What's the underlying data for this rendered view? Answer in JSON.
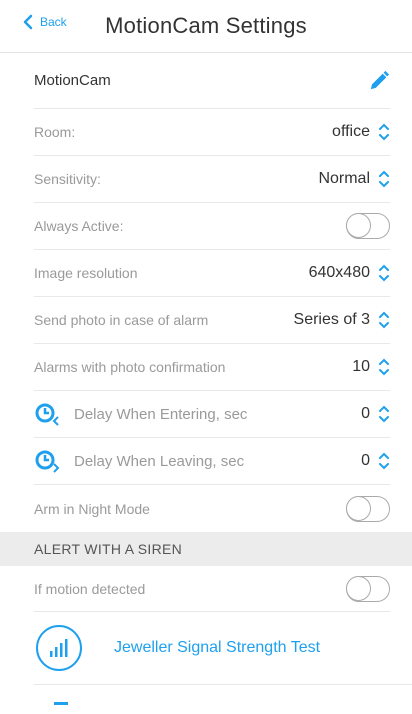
{
  "header": {
    "back_label": "Back",
    "title": "MotionCam Settings"
  },
  "device": {
    "name": "MotionCam",
    "edit_icon": "pencil-icon"
  },
  "settings": {
    "room": {
      "label": "Room:",
      "value": "office"
    },
    "sensitivity": {
      "label": "Sensitivity:",
      "value": "Normal"
    },
    "always_active": {
      "label": "Always Active:"
    },
    "image_resolution": {
      "label": "Image resolution",
      "value": "640x480"
    },
    "send_photo": {
      "label": "Send photo in case of alarm",
      "value": "Series of 3"
    },
    "alarms_photo": {
      "label": "Alarms with photo confirmation",
      "value": "10"
    },
    "delay_entering": {
      "label": "Delay When Entering, sec",
      "value": "0"
    },
    "delay_leaving": {
      "label": "Delay When Leaving, sec",
      "value": "0"
    },
    "night_mode": {
      "label": "Arm in Night Mode"
    }
  },
  "siren_section": {
    "title": "ALERT WITH A SIREN",
    "if_motion": {
      "label": "If motion detected"
    }
  },
  "signal_test": {
    "label": "Jeweller Signal Strength Test",
    "icon": "signal-strength-icon"
  },
  "colors": {
    "accent": "#1ea0ee",
    "section_bg": "#ececec"
  }
}
